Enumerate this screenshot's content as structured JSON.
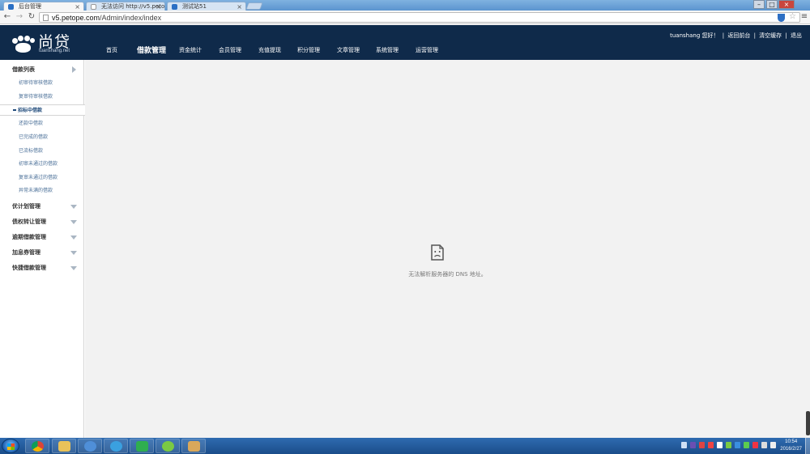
{
  "browser": {
    "tabs": [
      {
        "title": "后台管理",
        "active": true
      },
      {
        "title": "无法访问 http://v5.petop",
        "active": false
      },
      {
        "title": "测试站51",
        "active": false
      }
    ],
    "url_host": "v5.petope.com",
    "url_path": "/Admin/index/index"
  },
  "header": {
    "logo_text": "尚贷",
    "logo_sub": "tuanshang.net",
    "nav": [
      "首页",
      "借款管理",
      "资金统计",
      "会员管理",
      "充值提现",
      "积分管理",
      "文章管理",
      "系统管理",
      "运营管理"
    ],
    "active_nav": "借款管理",
    "user_greeting": "tuanshang 您好！",
    "user_links": [
      "返回前台",
      "清空缓存",
      "退出"
    ]
  },
  "sidebar": {
    "section_loan": "借款列表",
    "loan_items": [
      "初审待审核借款",
      "复审待审核借款",
      "招标中借款",
      "还款中借款",
      "已完成的借款",
      "已流标借款",
      "初审未通过的借款",
      "复审未通过的借款",
      "异常未满的借款"
    ],
    "active_item": "招标中借款",
    "sections": [
      "优计划管理",
      "债权转让管理",
      "逾期借款管理",
      "加息券管理",
      "快捷借款管理"
    ]
  },
  "main": {
    "error_text": "无法解析服务器的 DNS 地址。"
  },
  "taskbar": {
    "time": "10:54",
    "date": "2016/2/27"
  }
}
